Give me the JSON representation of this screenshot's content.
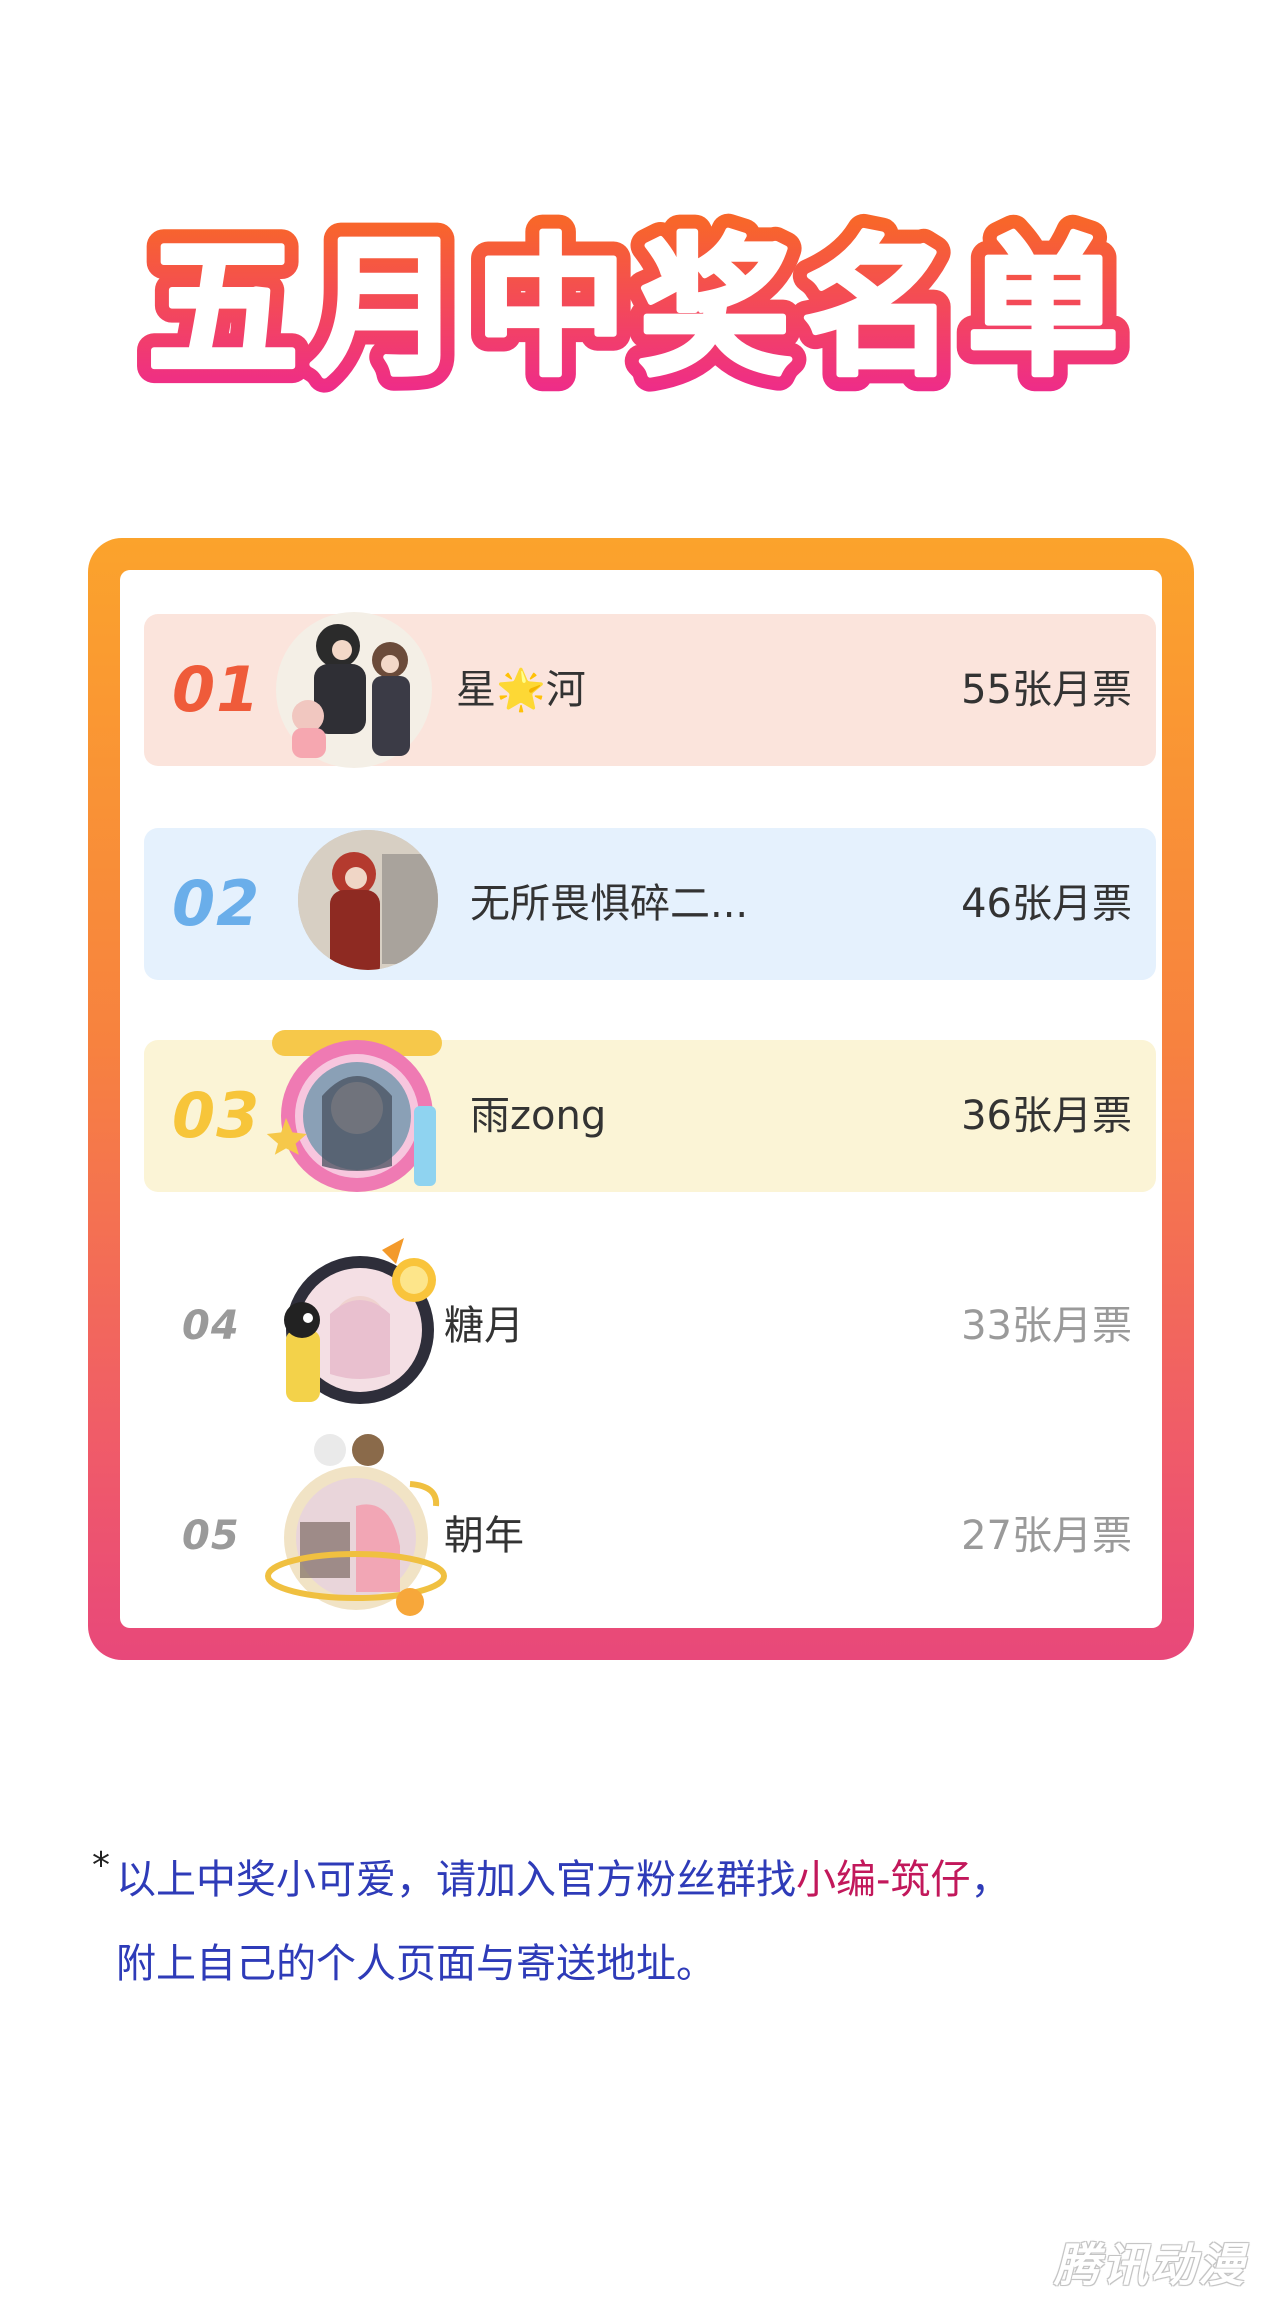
{
  "title": "五月中奖名单",
  "colors": {
    "title_fill": "#ffffff",
    "title_outline_top": "#f8662a",
    "title_outline_bottom": "#ee2a8c",
    "frame_top": "#fba32c",
    "frame_bottom": "#e8487a",
    "rank1": "#ef5b3a",
    "rank2": "#6aaeea",
    "rank3": "#f7c53a",
    "rank_other": "#9a9a9a",
    "note_text": "#2e3bb8",
    "note_highlight": "#c2185b"
  },
  "winners": [
    {
      "rank": "01",
      "name": "星🌟河",
      "votes": "55张月票",
      "avatar": "avatar-group-icon"
    },
    {
      "rank": "02",
      "name": "无所畏惧碎二...",
      "votes": "46张月票",
      "avatar": "avatar-red-hair-icon"
    },
    {
      "rank": "03",
      "name": "雨zong",
      "votes": "36张月票",
      "avatar": "avatar-pink-frame-icon"
    },
    {
      "rank": "04",
      "name": "糖月",
      "votes": "33张月票",
      "avatar": "avatar-lemon-frame-icon"
    },
    {
      "rank": "05",
      "name": "朝年",
      "votes": "27张月票",
      "avatar": "avatar-planet-frame-icon"
    }
  ],
  "note": {
    "star": "*",
    "line1_a": "以上中奖小可爱，请加入官方粉丝群找",
    "line1_highlight": "小编-筑仔",
    "line1_b": "，",
    "line2": "附上自己的个人页面与寄送地址。"
  },
  "watermark": "腾讯动漫"
}
